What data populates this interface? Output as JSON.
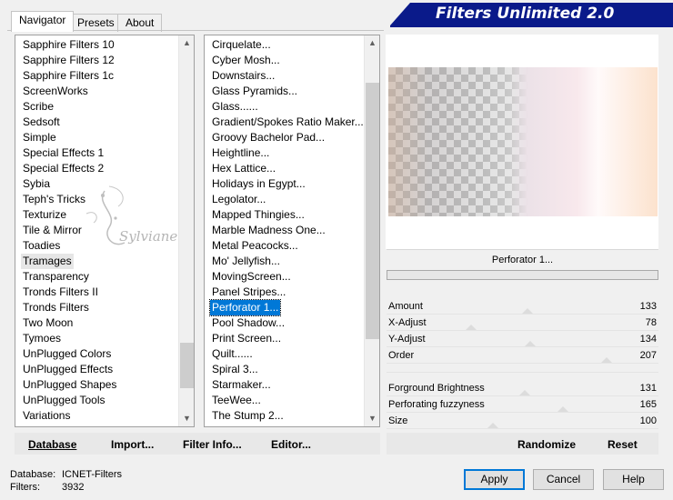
{
  "tabs": [
    {
      "label": "Navigator",
      "active": true
    },
    {
      "label": "Presets",
      "active": false
    },
    {
      "label": "About",
      "active": false
    }
  ],
  "banner_title": "Filters Unlimited 2.0",
  "categories": {
    "items": [
      "Sapphire Filters 10",
      "Sapphire Filters 12",
      "Sapphire Filters 1c",
      "ScreenWorks",
      "Scribe",
      "Sedsoft",
      "Simple",
      "Special Effects 1",
      "Special Effects 2",
      "Sybia",
      "Teph's Tricks",
      "Texturize",
      "Tile & Mirror",
      "Toadies",
      "Tramages",
      "Transparency",
      "Tronds Filters II",
      "Tronds Filters",
      "Two Moon",
      "Tymoes",
      "UnPlugged Colors",
      "UnPlugged Effects",
      "UnPlugged Shapes",
      "UnPlugged Tools",
      "Variations"
    ],
    "selected": "Tramages"
  },
  "filters": {
    "items": [
      "Cirquelate...",
      "Cyber Mosh...",
      "Downstairs...",
      "Glass Pyramids...",
      "Glass......",
      "Gradient/Spokes Ratio Maker...",
      "Groovy Bachelor Pad...",
      "Heightline...",
      "Hex Lattice...",
      "Holidays in Egypt...",
      "Legolator...",
      "Mapped Thingies...",
      "Marble Madness One...",
      "Metal Peacocks...",
      "Mo' Jellyfish...",
      "MovingScreen...",
      "Panel Stripes...",
      "Perforator 1...",
      "Pool Shadow...",
      "Print Screen...",
      "Quilt......",
      "Spiral 3...",
      "Starmaker...",
      "TeeWee...",
      "The Stump 2..."
    ],
    "selected": "Perforator 1..."
  },
  "watermark_text": "Sylviane",
  "current_filter": "Perforator 1...",
  "params": [
    {
      "label": "Amount",
      "value": "133",
      "level": 0.52
    },
    {
      "label": "X-Adjust",
      "value": "78",
      "level": 0.31
    },
    {
      "label": "Y-Adjust",
      "value": "134",
      "level": 0.53
    },
    {
      "label": "Order",
      "value": "207",
      "level": 0.81
    },
    {
      "label": "",
      "value": ""
    },
    {
      "label": "Forground Brightness",
      "value": "131",
      "level": 0.51
    },
    {
      "label": "Perforating fuzzyness",
      "value": "165",
      "level": 0.65
    },
    {
      "label": "Size",
      "value": "100",
      "level": 0.39
    }
  ],
  "toolbar": {
    "database": "Database",
    "import": "Import...",
    "filter_info": "Filter Info...",
    "editor": "Editor...",
    "randomize": "Randomize",
    "reset": "Reset"
  },
  "status": {
    "database_label": "Database:",
    "database_value": "ICNET-Filters",
    "filters_label": "Filters:",
    "filters_value": "3932"
  },
  "buttons": {
    "apply": "Apply",
    "cancel": "Cancel",
    "help": "Help"
  },
  "colors": {
    "banner": "#0a1a8a",
    "selection": "#0078d7"
  }
}
